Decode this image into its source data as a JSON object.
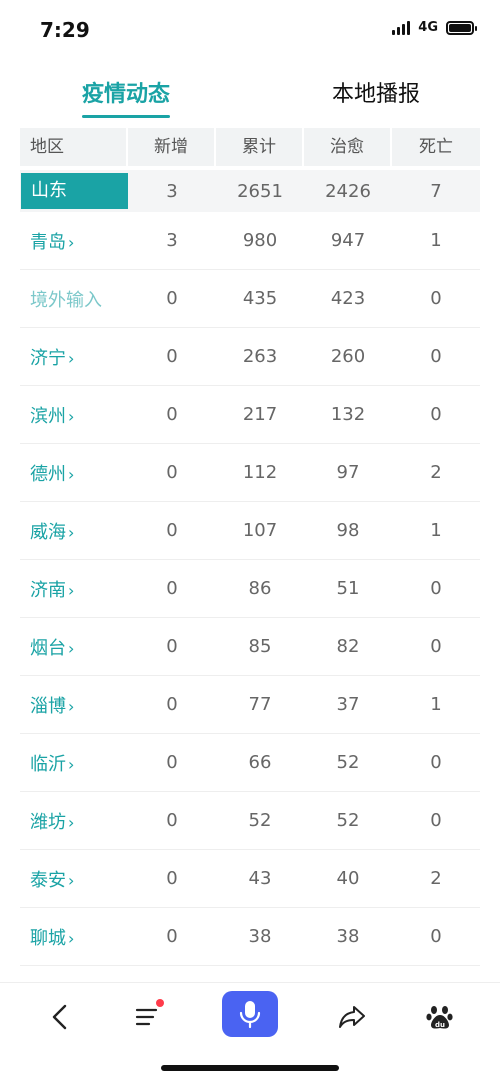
{
  "status_bar": {
    "time": "7:29",
    "network": "4G"
  },
  "tabs": [
    {
      "label": "疫情动态",
      "active": true
    },
    {
      "label": "本地播报",
      "active": false
    }
  ],
  "table": {
    "headers": [
      "地区",
      "新增",
      "累计",
      "治愈",
      "死亡"
    ],
    "province": {
      "region": "山东",
      "new": "3",
      "total": "2651",
      "cured": "2426",
      "deaths": "7"
    },
    "rows": [
      {
        "region": "青岛",
        "new": "3",
        "total": "980",
        "cured": "947",
        "deaths": "1",
        "link": true
      },
      {
        "region": "境外输入",
        "new": "0",
        "total": "435",
        "cured": "423",
        "deaths": "0",
        "link": false
      },
      {
        "region": "济宁",
        "new": "0",
        "total": "263",
        "cured": "260",
        "deaths": "0",
        "link": true
      },
      {
        "region": "滨州",
        "new": "0",
        "total": "217",
        "cured": "132",
        "deaths": "0",
        "link": true
      },
      {
        "region": "德州",
        "new": "0",
        "total": "112",
        "cured": "97",
        "deaths": "2",
        "link": true
      },
      {
        "region": "威海",
        "new": "0",
        "total": "107",
        "cured": "98",
        "deaths": "1",
        "link": true
      },
      {
        "region": "济南",
        "new": "0",
        "total": "86",
        "cured": "51",
        "deaths": "0",
        "link": true
      },
      {
        "region": "烟台",
        "new": "0",
        "total": "85",
        "cured": "82",
        "deaths": "0",
        "link": true
      },
      {
        "region": "淄博",
        "new": "0",
        "total": "77",
        "cured": "37",
        "deaths": "1",
        "link": true
      },
      {
        "region": "临沂",
        "new": "0",
        "total": "66",
        "cured": "52",
        "deaths": "0",
        "link": true
      },
      {
        "region": "潍坊",
        "new": "0",
        "total": "52",
        "cured": "52",
        "deaths": "0",
        "link": true
      },
      {
        "region": "泰安",
        "new": "0",
        "total": "43",
        "cured": "40",
        "deaths": "2",
        "link": true
      },
      {
        "region": "聊城",
        "new": "0",
        "total": "38",
        "cured": "38",
        "deaths": "0",
        "link": true
      }
    ]
  },
  "bottom_nav": {
    "icons": [
      "back-icon",
      "menu-icon",
      "microphone-icon",
      "share-icon",
      "baidu-paw-icon"
    ]
  },
  "colors": {
    "accent": "#1aa3a5",
    "mic": "#4a63f2",
    "notification": "#ff3b4a"
  }
}
